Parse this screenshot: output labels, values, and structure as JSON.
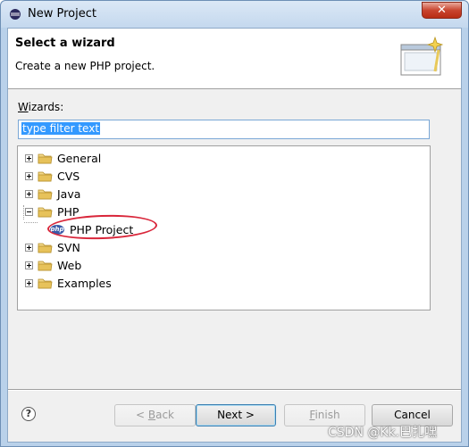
{
  "window": {
    "title": "New Project",
    "close_label": "✕"
  },
  "header": {
    "title": "Select a wizard",
    "description": "Create a new PHP project."
  },
  "filter": {
    "label_prefix": "W",
    "label_rest": "izards:",
    "value": "type filter text"
  },
  "tree": {
    "items": [
      {
        "label": "General",
        "expanded": false
      },
      {
        "label": "CVS",
        "expanded": false
      },
      {
        "label": "Java",
        "expanded": false
      },
      {
        "label": "PHP",
        "expanded": true
      },
      {
        "label": "PHP Project",
        "child": true,
        "icon": "php-icon"
      },
      {
        "label": "SVN",
        "expanded": false
      },
      {
        "label": "Web",
        "expanded": false
      },
      {
        "label": "Examples",
        "expanded": false
      }
    ]
  },
  "buttons": {
    "help": "?",
    "back_prefix": "< ",
    "back_mnemonic": "B",
    "back_rest": "ack",
    "next": "Next >",
    "finish_mnemonic": "F",
    "finish_rest": "inish",
    "cancel": "Cancel"
  },
  "watermark": "CSDN @Kk.巴扎嘿",
  "colors": {
    "highlight": "#d9263a",
    "selection": "#3399ff",
    "folder": "#e7c25a"
  }
}
